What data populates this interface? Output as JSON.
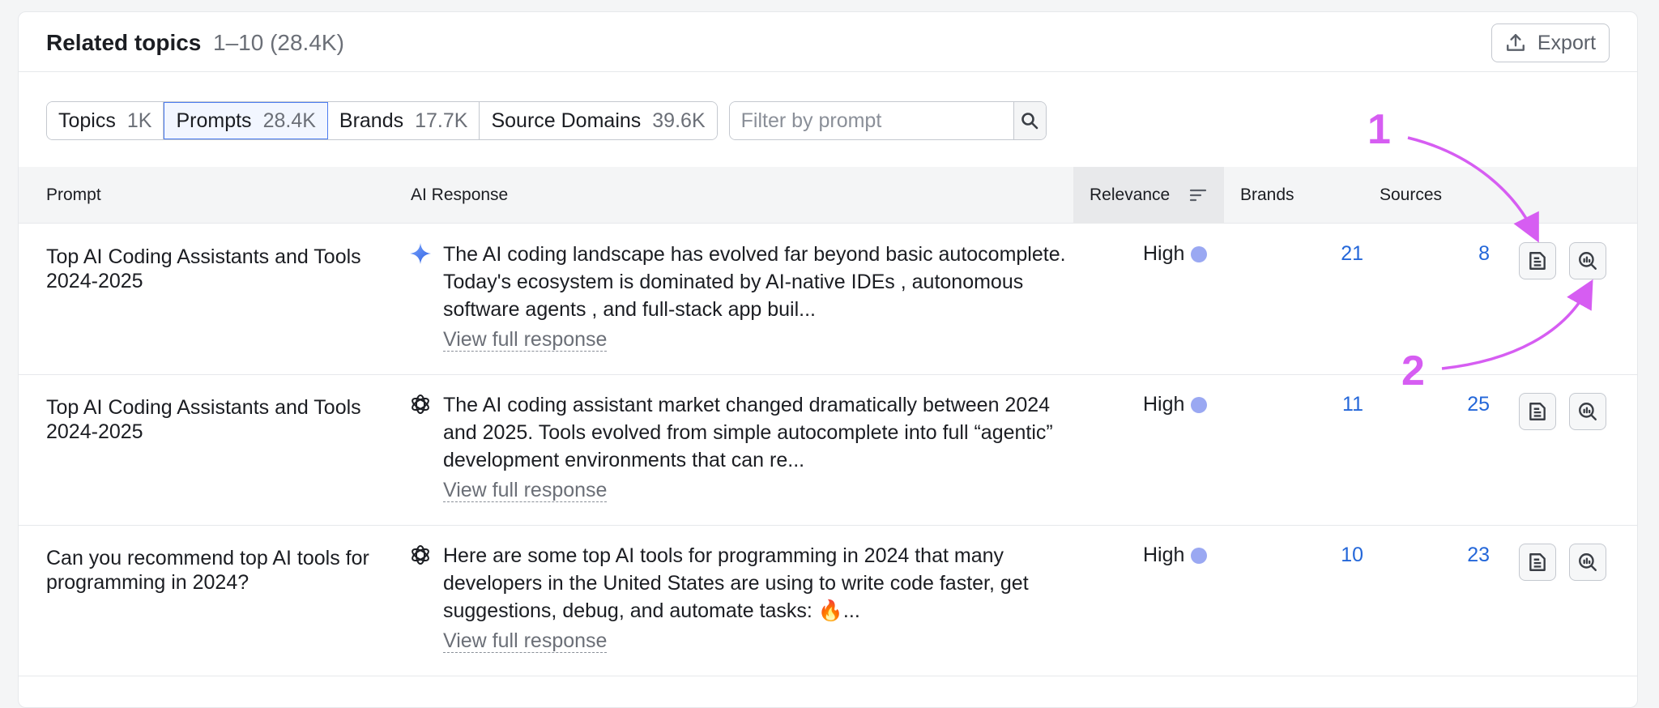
{
  "header": {
    "title": "Related topics",
    "range": "1–10 (28.4K)",
    "export_label": "Export"
  },
  "tabs": [
    {
      "label": "Topics",
      "count": "1K"
    },
    {
      "label": "Prompts",
      "count": "28.4K",
      "active": true
    },
    {
      "label": "Brands",
      "count": "17.7K"
    },
    {
      "label": "Source Domains",
      "count": "39.6K"
    }
  ],
  "filter": {
    "placeholder": "Filter by prompt"
  },
  "columns": {
    "prompt": "Prompt",
    "ai_response": "AI Response",
    "relevance": "Relevance",
    "brands": "Brands",
    "sources": "Sources"
  },
  "rows": [
    {
      "prompt": "Top AI Coding Assistants and Tools 2024-2025",
      "ai_icon": "gemini-sparkle-icon",
      "response": "The AI coding landscape has evolved far beyond basic autocomplete. Today's ecosystem is dominated by AI-native IDEs , autonomous software agents , and full-stack app buil...",
      "view_link": "View full response",
      "relevance": "High",
      "brands": "21",
      "sources": "8"
    },
    {
      "prompt": "Top AI Coding Assistants and Tools 2024-2025",
      "ai_icon": "openai-icon",
      "response": "The AI coding assistant market changed dramatically between 2024 and 2025. Tools evolved from simple autocomplete into full “agentic” development environments that can re...",
      "view_link": "View full response",
      "relevance": "High",
      "brands": "11",
      "sources": "25"
    },
    {
      "prompt": "Can you recommend top AI tools for programming in 2024?",
      "ai_icon": "openai-icon",
      "response": "Here are some top AI tools for programming in 2024 that many developers in the United States are using to write code faster, get suggestions, debug, and automate tasks: 🔥...",
      "view_link": "View full response",
      "relevance": "High",
      "brands": "10",
      "sources": "23"
    }
  ],
  "annotations": [
    {
      "label": "1"
    },
    {
      "label": "2"
    }
  ],
  "colors": {
    "accent": "#4c7cf0",
    "link": "#2467d9",
    "annotation": "#d65df2",
    "relevance_dot": "#9aa8f2"
  }
}
